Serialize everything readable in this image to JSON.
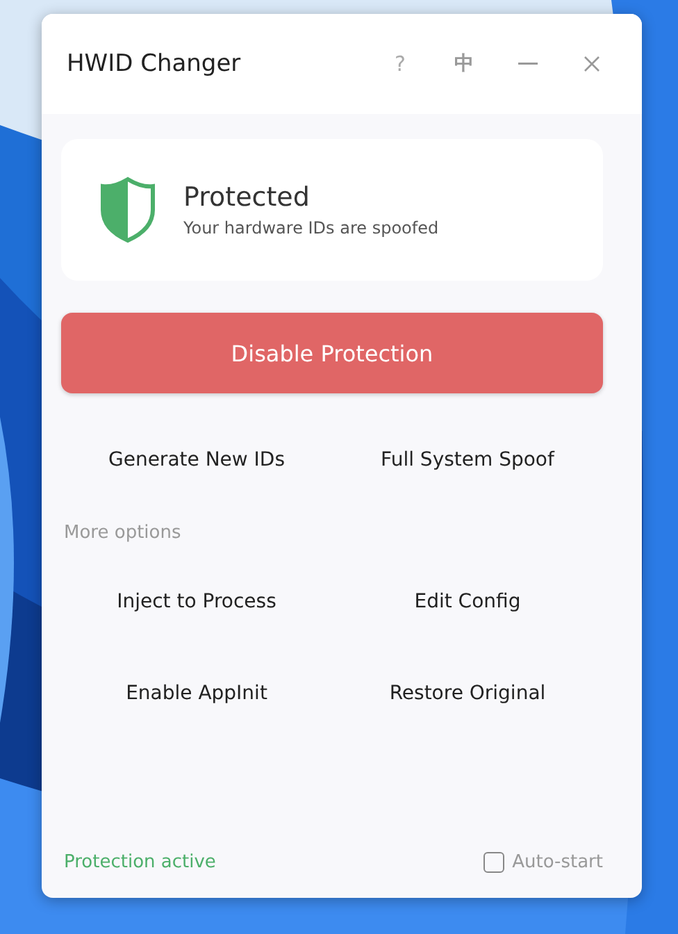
{
  "window": {
    "title": "HWID Changer",
    "help": "?",
    "language": "中"
  },
  "status": {
    "title": "Protected",
    "subtitle": "Your hardware IDs are spoofed",
    "protected": true
  },
  "primary_button": "Disable Protection",
  "actions": [
    "Generate New IDs",
    "Full System Spoof"
  ],
  "more_options_label": "More options",
  "more_actions": [
    "Inject to Process",
    "Edit Config",
    "Enable AppInit",
    "Restore Original"
  ],
  "footer": {
    "status": "Protection active",
    "autostart": {
      "label": "Auto-start",
      "checked": false
    }
  }
}
